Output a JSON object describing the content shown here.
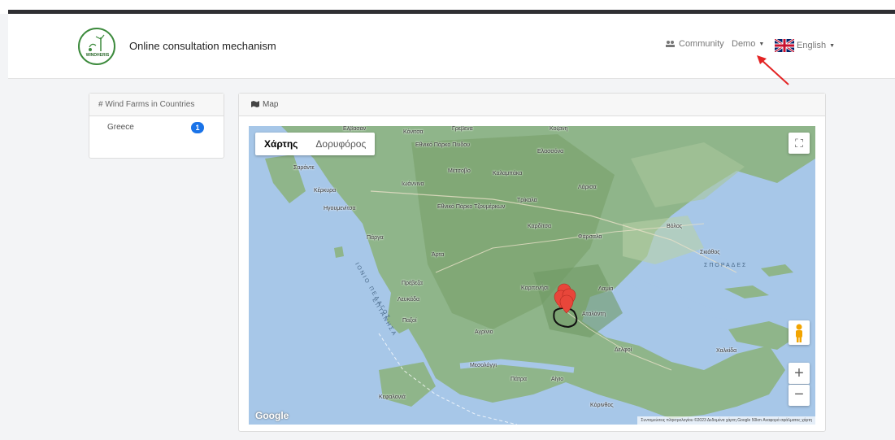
{
  "navbar": {
    "logo_text": "WINDHERIS",
    "brand": "Online consultation mechanism",
    "community": "Community",
    "demo": "Demo",
    "language": "English"
  },
  "sidebar": {
    "title": "# Wind Farms in Countries",
    "items": [
      {
        "label": "Greece",
        "count": "1"
      }
    ]
  },
  "map_card": {
    "title": "Map",
    "map_type": {
      "map": "Χάρτης",
      "satellite": "Δορυφόρος"
    },
    "zoom_in": "+",
    "zoom_out": "−",
    "google": "Google",
    "attribution": "Συντομεύσεις πληκτρολογίου  ©2023 Δεδομένα χάρτη Google  50km  Αναφορά σφάλματος χάρτη",
    "places": [
      "Ελβασάν",
      "Κόνιτσα",
      "Γρεβενά",
      "Κοζάνη",
      "Εθνικό Πάρκο Πίνδου",
      "Ελασσόνα",
      "Σαράντε",
      "Μέτσοβο",
      "Καλαμπάκα",
      "Ιωάννινα",
      "Λάρισα",
      "Κέρκυρα",
      "Ηγουμενίτσα",
      "Εθνικό Πάρκο Τζουμέρκων",
      "Τρίκαλα",
      "Καρδίτσα",
      "Φάρσαλα",
      "Βόλος",
      "Πάργα",
      "Άρτα",
      "Σκιάθος",
      "Πρέβεζα",
      "Καρπενήσι",
      "Λαμία",
      "Λευκάδα",
      "Αγρίνιο",
      "Αταλάντη",
      "Χαλκίδα",
      "Δελφοί",
      "Μεσολόγγι",
      "Πάτρα",
      "Αίγιο",
      "Κεφαλονιά",
      "Κόρινθος",
      "Παξοί"
    ],
    "seas": [
      "ΙΟΝΙΟ ΠΕΛΑΓΟΣ",
      "ΕΠΤΑΝΗΣΑ",
      "ΣΠΟΡΑΔΕΣ"
    ]
  },
  "colors": {
    "sea": "#a7c7e8",
    "land": "#8fb58a",
    "marker": "#e8463a",
    "badge": "#1a73e8",
    "arrow": "#e32424"
  }
}
